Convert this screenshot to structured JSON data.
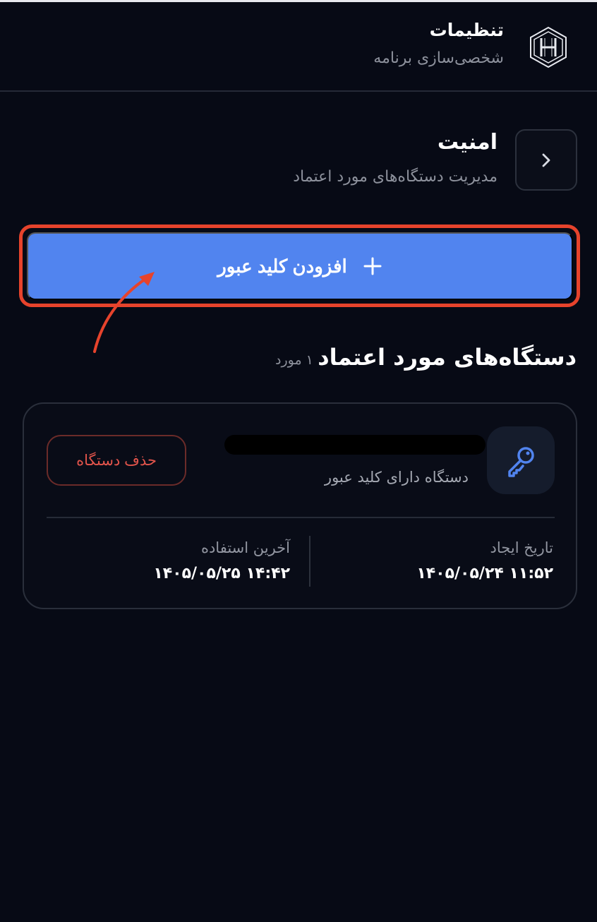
{
  "header": {
    "title": "تنظیمات",
    "subtitle": "شخصی‌سازی برنامه",
    "logo_icon": "hex-h-logo-icon"
  },
  "security": {
    "title": "امنیت",
    "subtitle": "مدیریت دستگاه‌های مورد اعتماد",
    "back_icon": "chevron-right-icon"
  },
  "add_passkey": {
    "label": "افزودن کلید عبور",
    "icon": "plus-icon"
  },
  "trusted_devices": {
    "heading": "دستگاه‌های مورد اعتماد",
    "count_label": "۱ مورد",
    "devices": [
      {
        "icon": "key-icon",
        "type_label": "دستگاه دارای کلید عبور",
        "delete_label": "حذف دستگاه",
        "created_label": "تاریخ ایجاد",
        "created_value": "۱۱:۵۲ ۱۴۰۵/۰۵/۲۴",
        "last_used_label": "آخرین استفاده",
        "last_used_value": "۱۴:۴۲ ۱۴۰۵/۰۵/۲۵"
      }
    ]
  },
  "colors": {
    "background": "#070a15",
    "accent": "#5184ef",
    "highlight": "#e6432c",
    "danger": "#e2544b"
  }
}
